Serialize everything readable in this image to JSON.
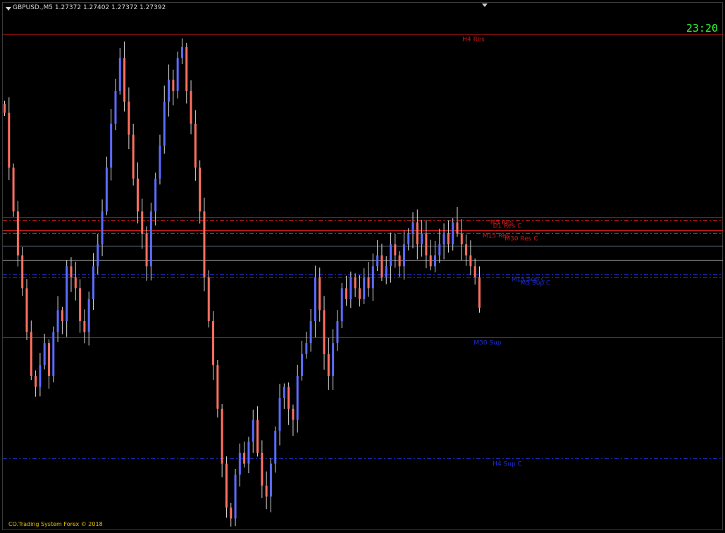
{
  "header": {
    "symbol_line": "GBPUSD.,M5  1.27372 1.27402 1.27372 1.27392"
  },
  "clock": "23:20",
  "copyright": "CO.Trading System Forex © 2018",
  "colors": {
    "background": "#000000",
    "bull_candle": "#5b6cff",
    "bear_candle": "#ff7060",
    "resistance": "#cc1f1f",
    "support": "#1e2fd6",
    "neutral_line": "#9aa0a8",
    "clock": "#33ff33",
    "copyright": "#e8c400"
  },
  "levels": [
    {
      "name": "H4 Res",
      "price": 1.27642,
      "color": "#d01818",
      "style": "solid",
      "label": "H4 Res"
    },
    {
      "name": "D1 Res",
      "price": 1.27475,
      "color": "#d01818",
      "style": "solid",
      "label": "M5 Res"
    },
    {
      "name": "D1 Res C",
      "price": 1.27472,
      "color": "#d01818",
      "style": "dashdot",
      "label": "D1 Res C"
    },
    {
      "name": "M15 Res",
      "price": 1.27463,
      "color": "#d01818",
      "style": "solid",
      "label": "M15 Res"
    },
    {
      "name": "M30 Res C",
      "price": 1.2746,
      "color": "#d01818",
      "style": "dashdot",
      "label": "M30 Res C"
    },
    {
      "name": "Pivot A",
      "price": 1.27449,
      "color": "#6c7a8a",
      "style": "solid",
      "label": ""
    },
    {
      "name": "Pivot B",
      "price": 1.27436,
      "color": "#b0b0b0",
      "style": "solid",
      "label": ""
    },
    {
      "name": "M15 Sup C",
      "price": 1.27423,
      "color": "#1e2fd6",
      "style": "dashdot",
      "label": "M15 Sup C"
    },
    {
      "name": "M5 Sup C",
      "price": 1.2742,
      "color": "#1e2fd6",
      "style": "dashdot",
      "label": "M5 Sup C"
    },
    {
      "name": "M30 Sup",
      "price": 1.27365,
      "color": "#1e2fd6",
      "style": "solid",
      "label": "M30 Sup"
    },
    {
      "name": "H4 Sup C",
      "price": 1.27255,
      "color": "#1e2fd6",
      "style": "dashdot",
      "label": "H4 Sup C"
    }
  ],
  "chart_data": {
    "type": "candlestick",
    "symbol": "GBPUSD.",
    "timeframe": "M5",
    "last_bar": {
      "open": 1.27372,
      "high": 1.27402,
      "low": 1.27372,
      "close": 1.27392
    },
    "closes": [
      1.2757,
      1.2752,
      1.2748,
      1.2744,
      1.2741,
      1.2737,
      1.2733,
      1.2732,
      1.2734,
      1.2736,
      1.2733,
      1.2737,
      1.2739,
      1.2738,
      1.2743,
      1.2742,
      1.2741,
      1.2738,
      1.2737,
      1.274,
      1.2743,
      1.2745,
      1.2748,
      1.2752,
      1.2756,
      1.2759,
      1.2762,
      1.2758,
      1.2755,
      1.2751,
      1.2748,
      1.2746,
      1.2743,
      1.2748,
      1.2751,
      1.2754,
      1.2758,
      1.276,
      1.2759,
      1.2762,
      1.2763,
      1.2759,
      1.2756,
      1.2752,
      1.2748,
      1.2742,
      1.2738,
      1.2734,
      1.273,
      1.2725,
      1.2721,
      1.272,
      1.2724,
      1.2726,
      1.2725,
      1.2727,
      1.2729,
      1.2726,
      1.2723,
      1.2722,
      1.2725,
      1.2728,
      1.2731,
      1.2732,
      1.273,
      1.2729,
      1.2733,
      1.2735,
      1.2736,
      1.2738,
      1.2742,
      1.2739,
      1.2735,
      1.2733,
      1.2736,
      1.2738,
      1.2741,
      1.274,
      1.2742,
      1.2741,
      1.274,
      1.2742,
      1.2741,
      1.2743,
      1.2744,
      1.2742,
      1.2743,
      1.2745,
      1.2744,
      1.2743,
      1.2745,
      1.2746,
      1.2747,
      1.2745,
      1.2746,
      1.2744,
      1.2743,
      1.2744,
      1.2745,
      1.2746,
      1.2745,
      1.2747,
      1.2746,
      1.2745,
      1.2744,
      1.2743,
      1.2742,
      1.27392
    ],
    "ylim": [
      1.2719,
      1.2766
    ]
  }
}
